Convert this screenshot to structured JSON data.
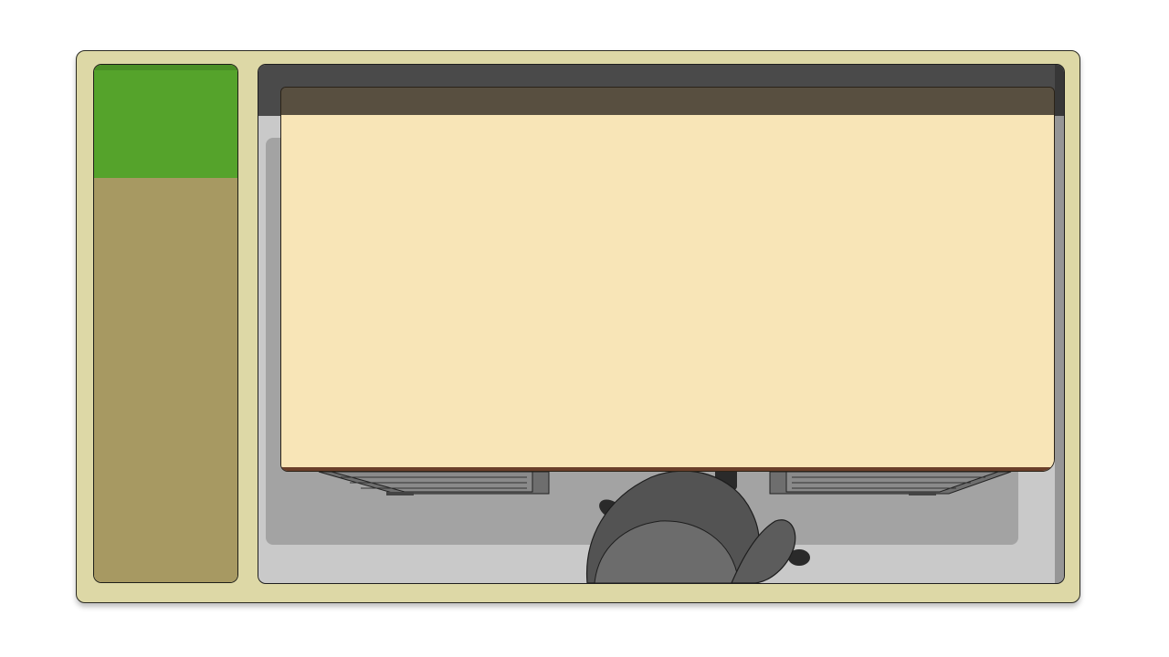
{
  "scene": {
    "view": "top-down office",
    "colors": {
      "frame": "#ddd8a6",
      "sidebar_top": "#55a32b",
      "sidebar_bottom": "#a79962",
      "room_floor": "#c9c9c9",
      "room_wall": "#4a4a4a",
      "rug": "#a3a3a3",
      "desk_surface": "#f8e5b7",
      "desk_strip": "#584f40",
      "chair": "#535353"
    },
    "icons": {
      "chair": "office-chair-icon",
      "drawer": "desk-drawer-icon"
    }
  }
}
